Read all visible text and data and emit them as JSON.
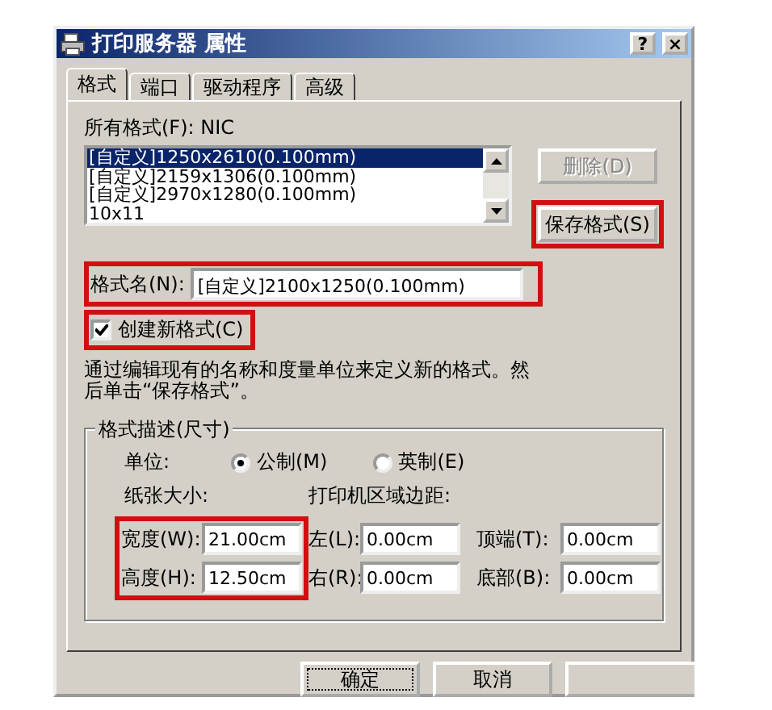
{
  "window": {
    "title": "打印服务器 属性",
    "buttons": [
      "?",
      "×"
    ]
  },
  "tabs": [
    {
      "label": "格式",
      "selected": true
    },
    {
      "label": "端口",
      "selected": false
    },
    {
      "label": "驱动程序",
      "selected": false
    },
    {
      "label": "高级",
      "selected": false
    }
  ],
  "formats": {
    "label": "所有格式(F): NIC",
    "items": [
      {
        "text": "[自定义]1250x2610(0.100mm)",
        "selected": true
      },
      {
        "text": "[自定义]2159x1306(0.100mm)",
        "selected": false
      },
      {
        "text": "[自定义]2970x1280(0.100mm)",
        "selected": false
      },
      {
        "text": "10x11",
        "selected": false
      }
    ]
  },
  "side_buttons": [
    {
      "label": "删除(D)",
      "disabled": true,
      "highlighted": false
    },
    {
      "label": "保存格式(S)",
      "disabled": false,
      "highlighted": true
    }
  ],
  "format_name": {
    "label": "格式名(N):",
    "value": "[自定义]2100x1250(0.100mm)",
    "highlighted": true
  },
  "create_new": {
    "label": "创建新格式(C)",
    "checked": true,
    "highlighted": true
  },
  "hint": "通过编辑现有的名称和度量单位来定义新的格式。然后单击“保存格式”。",
  "group": {
    "title": "格式描述(尺寸)",
    "unit_label": "单位:",
    "units": [
      {
        "label": "公制(M)",
        "selected": true
      },
      {
        "label": "英制(E)",
        "selected": false
      }
    ],
    "paper_label": "纸张大小:",
    "margin_label": "打印机区域边距:",
    "paper_highlighted": true,
    "paper_fields": [
      {
        "label": "宽度(W):",
        "value": "21.00cm"
      },
      {
        "label": "高度(H):",
        "value": "12.50cm"
      }
    ],
    "margin_fields": [
      {
        "label": "左(L):",
        "value": "0.00cm"
      },
      {
        "label": "顶端(T):",
        "value": "0.00cm"
      },
      {
        "label": "右(R):",
        "value": "0.00cm"
      },
      {
        "label": "底部(B):",
        "value": "0.00cm"
      }
    ]
  },
  "footer_buttons": [
    {
      "label": "确定",
      "default": true
    },
    {
      "label": "取消",
      "default": false
    }
  ]
}
